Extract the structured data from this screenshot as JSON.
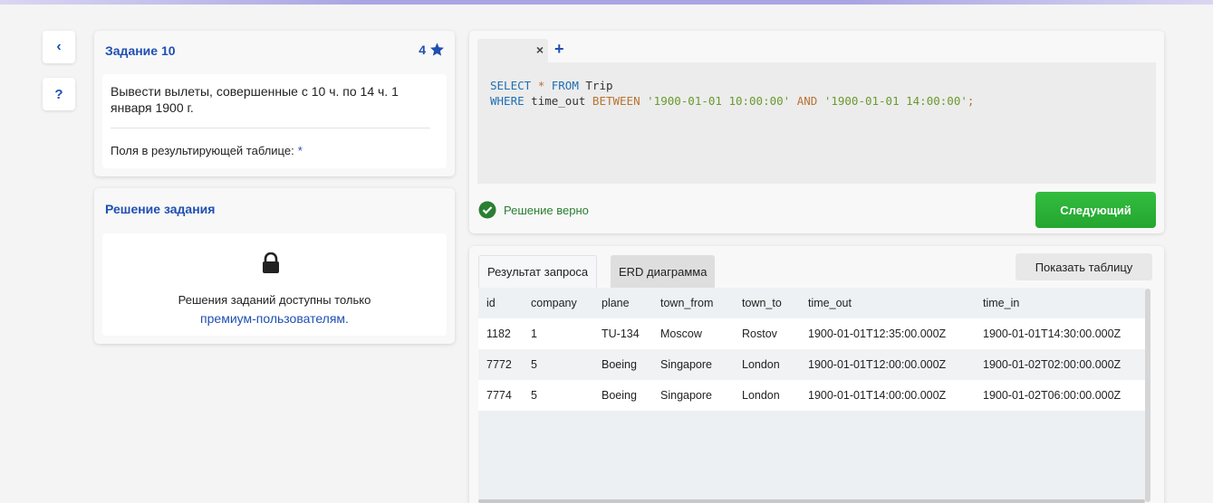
{
  "sidebar": {
    "back_symbol": "‹",
    "help_symbol": "?"
  },
  "task": {
    "title": "Задание 10",
    "points": "4",
    "description": "Вывести вылеты, совершенные с 10 ч. по 14 ч. 1 января 1900 г.",
    "fields_label": "Поля в результирующей таблице:",
    "fields_value": "*"
  },
  "solution": {
    "title": "Решение задания",
    "locked_text": "Решения заданий доступны только",
    "locked_link": "премиум-пользователям."
  },
  "editor": {
    "tab_close": "×",
    "add_tab": "+",
    "line1": {
      "kw1": "SELECT",
      "op": "*",
      "kw2": "FROM",
      "table": "Trip"
    },
    "line2": {
      "kw1": "WHERE",
      "col": "time_out",
      "kw2": "BETWEEN",
      "str1": "'1900-01-01 10:00:00'",
      "kw3": "AND",
      "str2": "'1900-01-01 14:00:00'",
      "end": ";"
    }
  },
  "status": {
    "text": "Решение верно",
    "color": "#2a7f32"
  },
  "next_button": "Следующий",
  "results": {
    "tabs": [
      "Результат запроса",
      "ERD диаграмма"
    ],
    "show_table_button": "Показать таблицу",
    "columns": [
      "id",
      "company",
      "plane",
      "town_from",
      "town_to",
      "time_out",
      "time_in"
    ],
    "rows": [
      [
        "1182",
        "1",
        "TU-134",
        "Moscow",
        "Rostov",
        "1900-01-01T12:35:00.000Z",
        "1900-01-01T14:30:00.000Z"
      ],
      [
        "7772",
        "5",
        "Boeing",
        "Singapore",
        "London",
        "1900-01-01T12:00:00.000Z",
        "1900-01-02T02:00:00.000Z"
      ],
      [
        "7774",
        "5",
        "Boeing",
        "Singapore",
        "London",
        "1900-01-01T14:00:00.000Z",
        "1900-01-02T06:00:00.000Z"
      ]
    ]
  },
  "colors": {
    "accent": "#1f4fb3",
    "success_button": "#2bb237"
  }
}
